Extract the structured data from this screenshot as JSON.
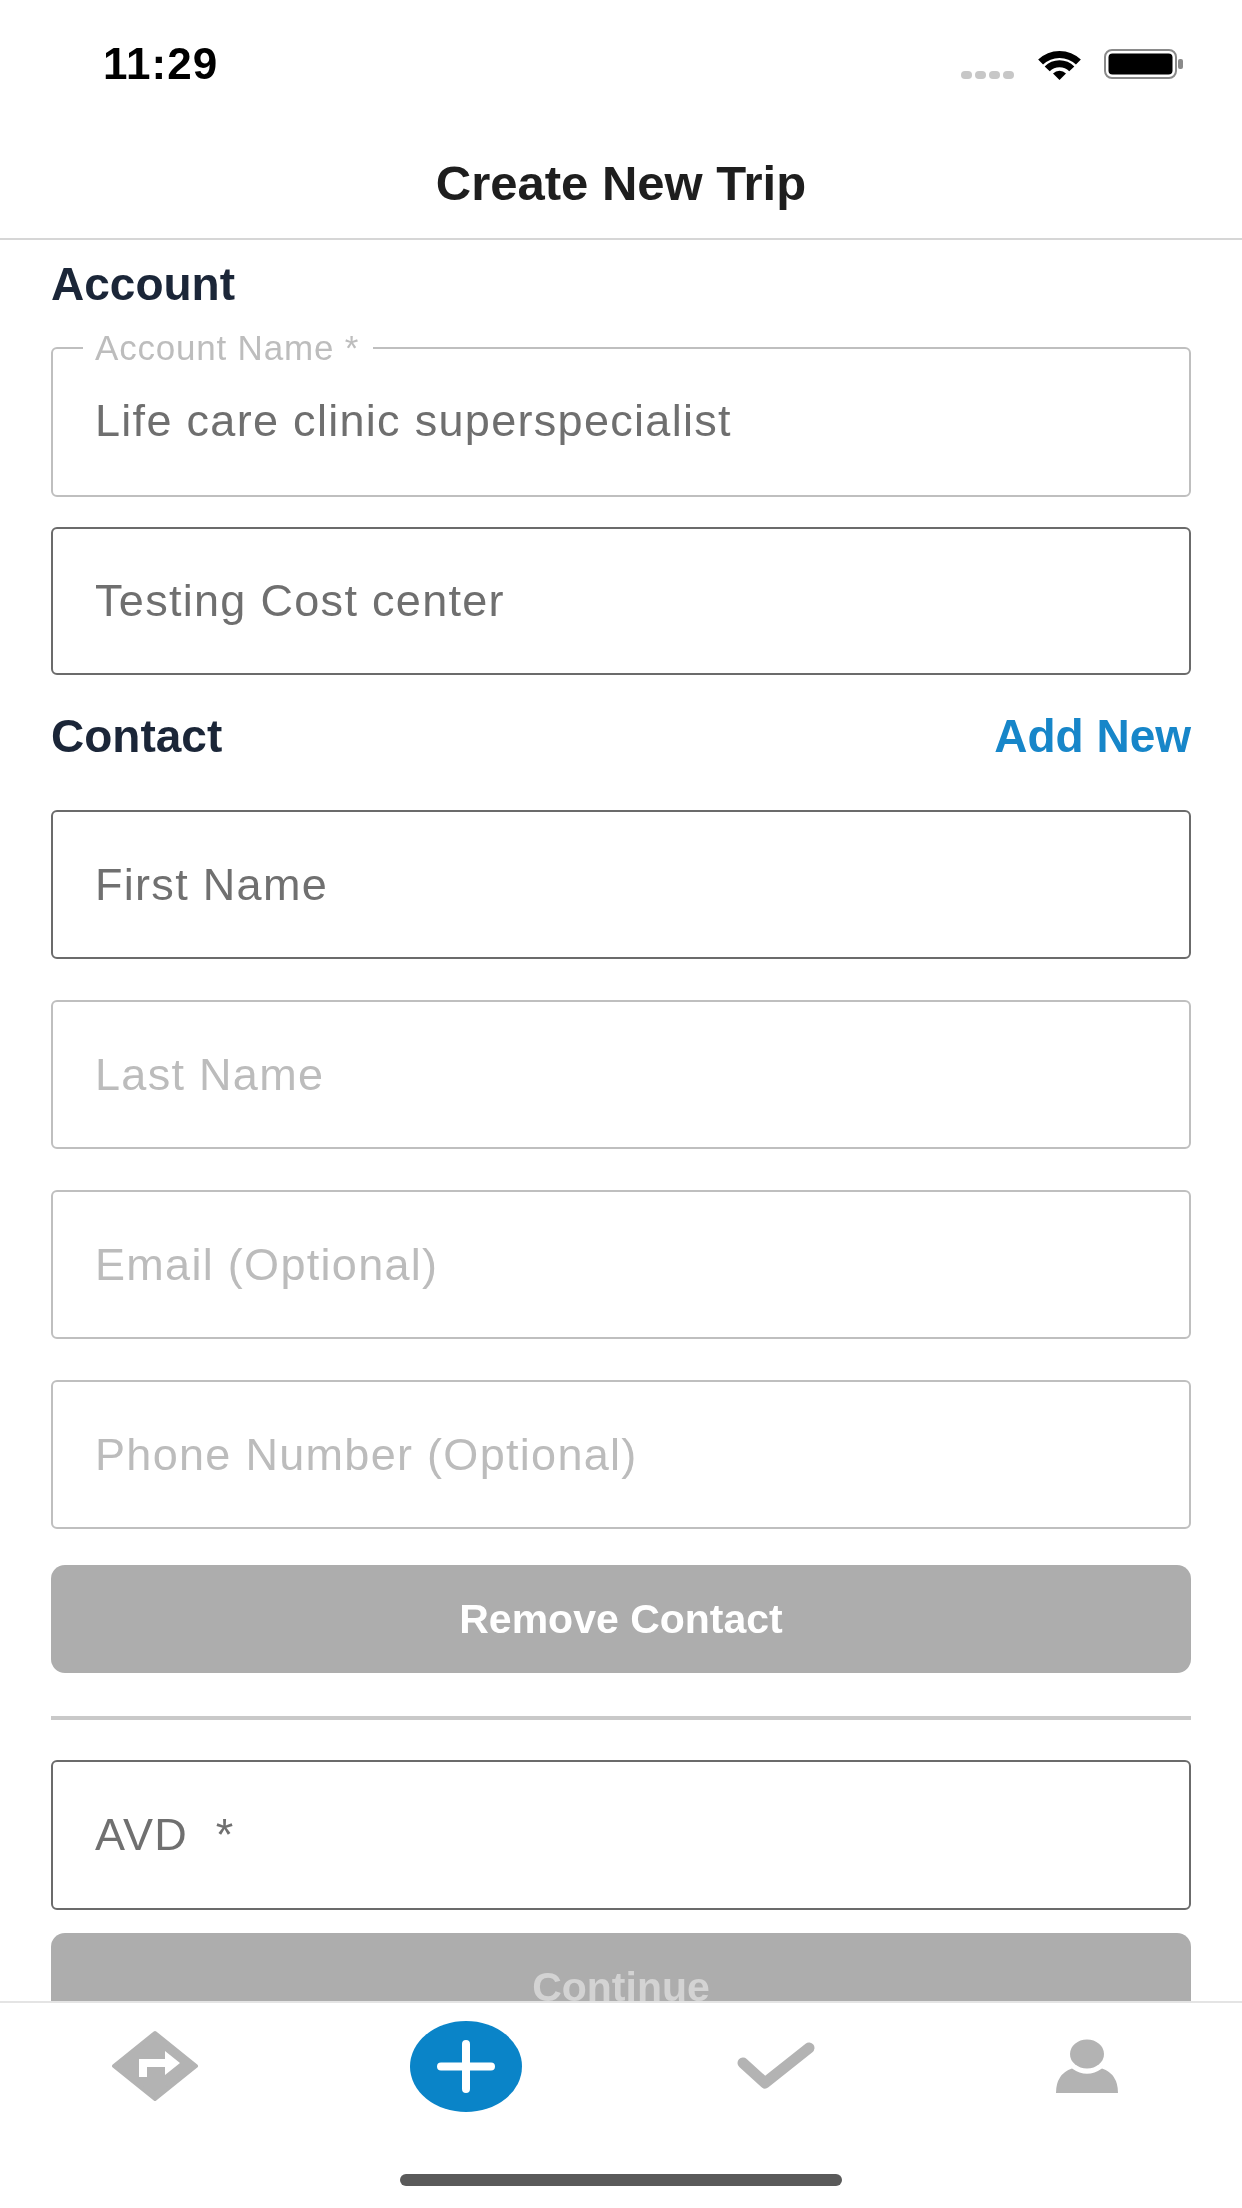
{
  "status_bar": {
    "time": "11:29"
  },
  "header": {
    "title": "Create New Trip"
  },
  "account": {
    "heading": "Account",
    "fields": [
      {
        "label": "Account Name *",
        "value": "Life care clinic superspecialist",
        "emphasized": false
      },
      {
        "value": "Testing Cost center",
        "emphasized": true
      }
    ]
  },
  "contact": {
    "heading": "Contact",
    "add_new": "Add New",
    "fields": [
      {
        "placeholder": "First Name",
        "emphasized": true
      },
      {
        "placeholder": "Last Name",
        "emphasized": false
      },
      {
        "placeholder": "Email (Optional)",
        "emphasized": false
      },
      {
        "placeholder": "Phone Number (Optional)",
        "emphasized": false
      }
    ],
    "remove_button": {
      "label": "Remove Contact",
      "disabled": false
    }
  },
  "avd_field": {
    "placeholder": "AVD  *",
    "emphasized": true
  },
  "continue_button": {
    "label": "Continue",
    "disabled": true
  },
  "tab_bar": {
    "tabs": [
      {
        "kind": "route",
        "selected": false
      },
      {
        "kind": "add",
        "selected": true
      },
      {
        "kind": "check",
        "selected": false
      },
      {
        "kind": "profile",
        "selected": false
      }
    ]
  }
}
